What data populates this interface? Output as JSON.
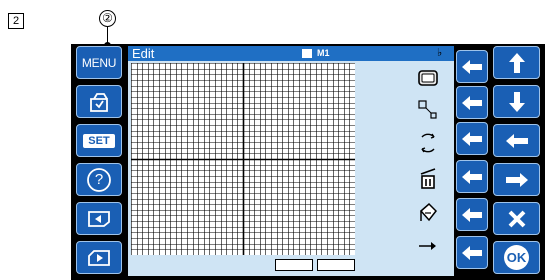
{
  "annotations": {
    "figure_number": "2",
    "callout": "②"
  },
  "left_panel": {
    "menu_label": "MENU",
    "set_label": "SET",
    "help_label": "?"
  },
  "screen": {
    "title": "Edit",
    "memory_label": "M1",
    "grid": {
      "cols": 40,
      "rows": 34
    }
  },
  "tools": [
    "frame-icon",
    "resize-icon",
    "rotate-icon",
    "delete-icon",
    "fill-icon",
    "move-right-icon"
  ],
  "right_panel": {
    "ok_label": "OK"
  },
  "colors": {
    "button_blue": "#1a5fb4",
    "title_blue": "#1f6fc4",
    "screen_bg": "#cfe4f4"
  }
}
